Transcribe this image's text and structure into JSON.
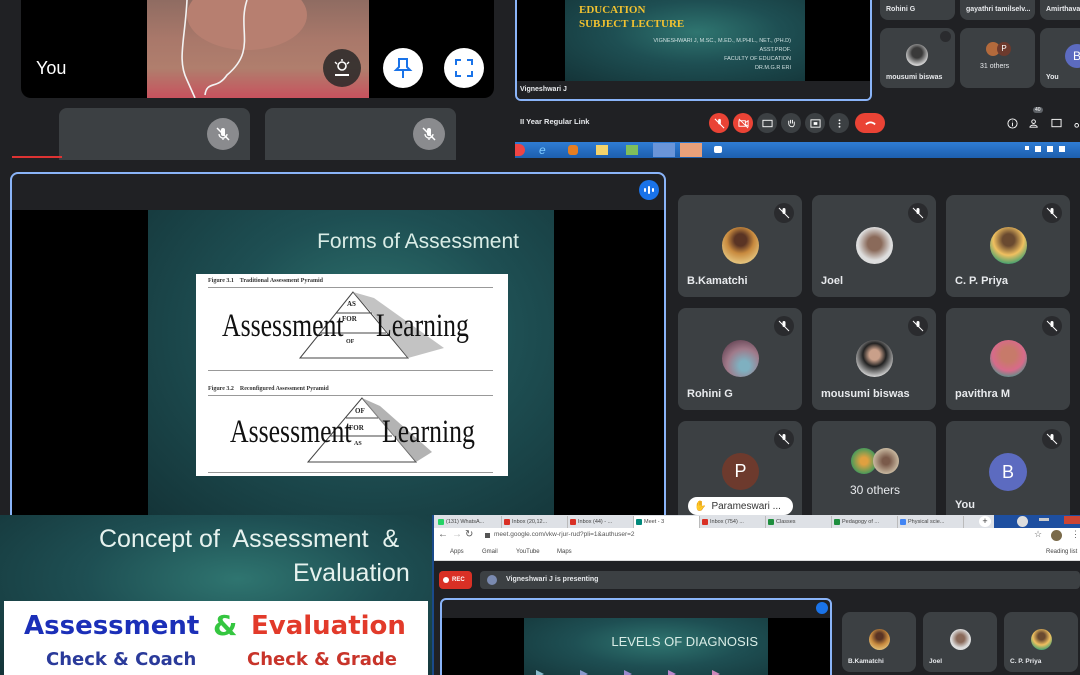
{
  "panel1": {
    "self_label": "You",
    "buttons": {
      "effects": "Apply visual effects",
      "pin": "Pin",
      "fullscreen": "Full screen"
    }
  },
  "panel2": {
    "slide": {
      "title_lines": [
        "EDUCATION",
        "SUBJECT LECTURE"
      ],
      "author_lines": [
        "VIGNESHWARI J, M.SC., M.ED., M.PHIL., NET., (PH.D)",
        "ASST.PROF.",
        "FACULTY OF EDUCATION",
        "DR.M.G.R ERI"
      ]
    },
    "presenter": "Vigneshwari J",
    "meeting_name": "II Year Regular Link",
    "participants_top": [
      {
        "name": "Rohini G"
      },
      {
        "name": "gayathri tamilselv..."
      },
      {
        "name": "Amirthavalli..."
      }
    ],
    "participants": [
      {
        "name": "mousumi biswas"
      },
      {
        "name": "31 others"
      },
      {
        "name": "You",
        "initial": "B"
      }
    ],
    "participant_badge": "40",
    "controls": [
      "mic-off",
      "camera-off",
      "captions",
      "raise-hand",
      "present",
      "more",
      "leave"
    ],
    "right_controls": [
      "info",
      "people",
      "chat",
      "activities"
    ]
  },
  "panel3": {
    "slide": {
      "title": "Forms of Assessment",
      "fig1_caption": "Figure 3.1    Traditional Assessment Pyramid",
      "fig2_caption": "Figure 3.2    Reconfigured Assessment Pyramid",
      "fig1_levels": [
        "AS",
        "FOR",
        "OF"
      ],
      "fig2_levels": [
        "OF",
        "FOR",
        "AS"
      ],
      "left_word": "Assessment",
      "right_word": "Learning"
    },
    "participants": [
      {
        "name": "B.Kamatchi",
        "muted": true
      },
      {
        "name": "Joel",
        "muted": true
      },
      {
        "name": "C. P. Priya",
        "muted": true
      },
      {
        "name": "Rohini G",
        "muted": true
      },
      {
        "name": "mousumi biswas",
        "muted": true
      },
      {
        "name": "pavithra M",
        "muted": true
      },
      {
        "name": "Parameswari ...",
        "initial": "P",
        "muted": true,
        "raised_hand": true
      },
      {
        "name": "30 others"
      },
      {
        "name": "You",
        "initial": "B",
        "muted": true
      }
    ]
  },
  "panel4": {
    "slide": {
      "title_line1": "Concept of  Assessment  &",
      "title_line2": "Evaluation",
      "word_a": "Assessment",
      "amp": "&",
      "word_b": "Evaluation",
      "sub_a": "Check & Coach",
      "sub_b": "Check & Grade"
    }
  },
  "panel5": {
    "tabs": [
      {
        "label": "(131) WhatsA..."
      },
      {
        "label": "Inbox (20,12..."
      },
      {
        "label": "Inbox (44) - ..."
      },
      {
        "label": "Meet - 3"
      },
      {
        "label": "Inbox (754) ..."
      },
      {
        "label": "Classes"
      },
      {
        "label": "Pedagogy of ..."
      },
      {
        "label": "Physical scie..."
      }
    ],
    "active_tab": 3,
    "url": "meet.google.com/vkw-rjur-rud?pli=1&authuser=2",
    "bookmarks": [
      "Apps",
      "Gmail",
      "YouTube",
      "Maps"
    ],
    "reading_list": "Reading list",
    "rec_label": "REC",
    "presenting_text": "Vigneshwari J is presenting",
    "slide_title": "LEVELS OF DIAGNOSIS",
    "participants": [
      {
        "name": "B.Kamatchi"
      },
      {
        "name": "Joel"
      },
      {
        "name": "C. P. Priya"
      }
    ]
  },
  "colors": {
    "meet_bg": "#202124",
    "tile": "#3c4043",
    "accent_blue": "#1a73e8",
    "end_red": "#ea4335",
    "slide_title_yellow": "#f2c230"
  }
}
